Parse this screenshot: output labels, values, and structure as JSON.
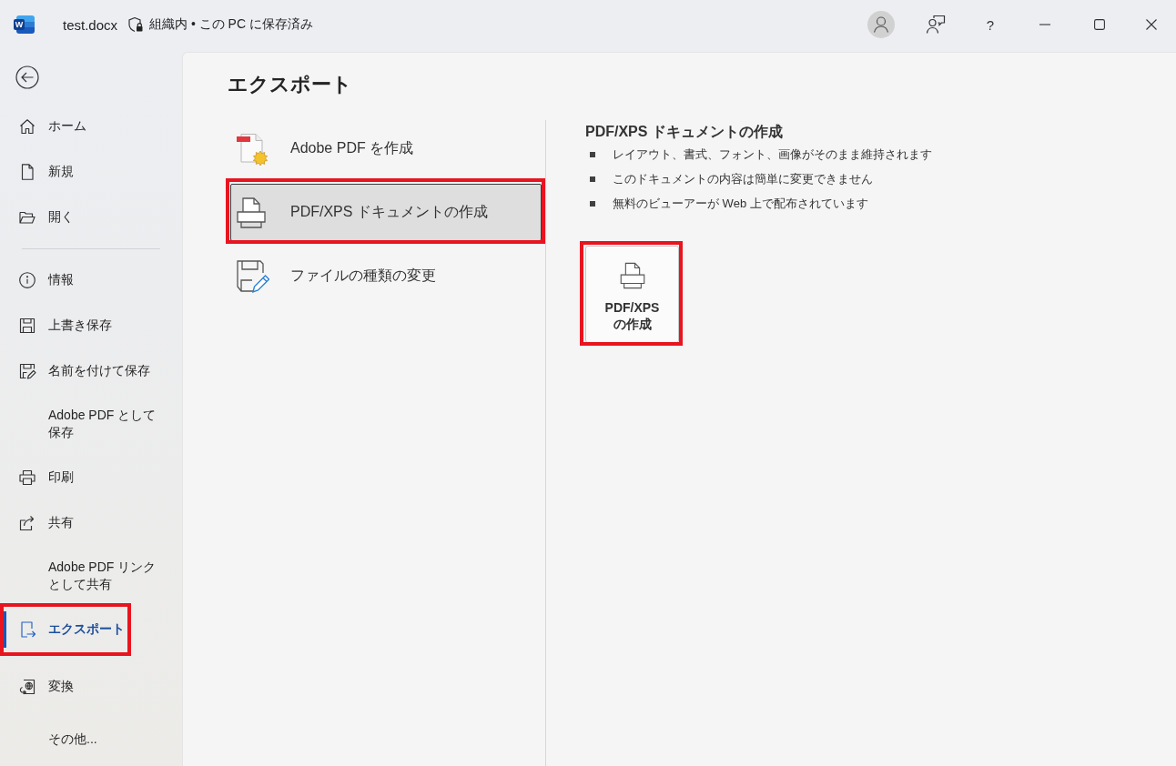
{
  "title_bar": {
    "logo_letter": "W",
    "filename": "test.docx",
    "save_status": "組織内 • この PC に保存済み",
    "help": "?"
  },
  "sidebar": {
    "primary": [
      {
        "label": "ホーム",
        "selected": false,
        "annotated": false
      },
      {
        "label": "新規",
        "selected": false,
        "annotated": false
      },
      {
        "label": "開く",
        "selected": false,
        "annotated": false
      }
    ],
    "secondary": [
      {
        "label": "情報",
        "selected": false,
        "annotated": false
      },
      {
        "label": "上書き保存",
        "selected": false,
        "annotated": false
      },
      {
        "label": "名前を付けて保存",
        "selected": false,
        "annotated": false
      },
      {
        "label": "Adobe PDF として保存",
        "selected": false,
        "annotated": false
      },
      {
        "label": "印刷",
        "selected": false,
        "annotated": false
      },
      {
        "label": "共有",
        "selected": false,
        "annotated": false
      },
      {
        "label": "Adobe PDF リンクとして共有",
        "selected": false,
        "annotated": false
      },
      {
        "label": "エクスポート",
        "selected": true,
        "annotated": true
      }
    ],
    "footer": [
      {
        "label": "変換",
        "selected": false,
        "annotated": false
      },
      {
        "label": "その他...",
        "selected": false,
        "annotated": false
      }
    ]
  },
  "export": {
    "title": "エクスポート",
    "options": [
      {
        "label": "Adobe PDF を作成",
        "selected": false,
        "annotated": false
      },
      {
        "label": "PDF/XPS ドキュメントの作成",
        "selected": true,
        "annotated": true
      },
      {
        "label": "ファイルの種類の変更",
        "selected": false,
        "annotated": false
      }
    ],
    "detail": {
      "heading": "PDF/XPS ドキュメントの作成",
      "bullets": [
        "レイアウト、書式、フォント、画像がそのまま維持されます",
        "このドキュメントの内容は簡単に変更できません",
        "無料のビューアーが Web 上で配布されています"
      ],
      "action": {
        "label": "PDF/XPS\nの作成",
        "annotated": true
      }
    }
  }
}
